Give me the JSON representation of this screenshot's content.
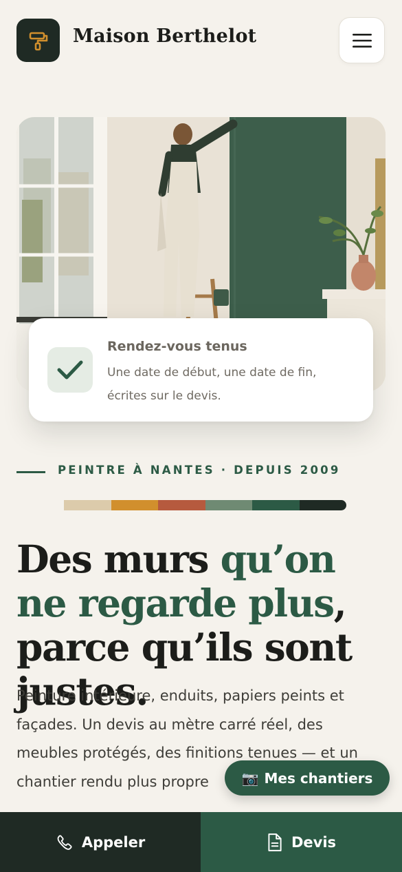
{
  "header": {
    "brand": "Maison Berthelot",
    "logo_icon": "paint-roller-icon",
    "menu_icon": "hamburger-menu-icon"
  },
  "hero": {
    "image_alt": "Peintre en salopette peignant un mur vert sauge dans un appartement haussmannien"
  },
  "card": {
    "icon": "checkmark-icon",
    "title": "Rendez-vous tenus",
    "text": "Une date de début, une date de fin, écrites sur le devis."
  },
  "eyebrow": "PEINTRE À NANTES · DEPUIS 2009",
  "palette": [
    "#dccbab",
    "#d18f2d",
    "#b65a3e",
    "#6f8a73",
    "#2c5a45",
    "#1f2a24"
  ],
  "headline": {
    "part1": "Des murs ",
    "accent": "qu’on ne regarde plus",
    "part2": ", parce qu’ils sont justes."
  },
  "lead": "Peinture intérieure, enduits, papiers peints et façades. Un devis au mètre carré réel, des meubles protégés, des finitions tenues — et un chantier rendu plus propre",
  "pill": {
    "emoji": "📷",
    "label": "Mes chantiers"
  },
  "bottom_bar": {
    "call_label": "Appeler",
    "call_icon": "phone-icon",
    "quote_label": "Devis",
    "quote_icon": "document-icon"
  },
  "colors": {
    "background": "#f5f2ec",
    "primary_green": "#2c5a45",
    "dark": "#1f2a24",
    "accent_ochre": "#d18f2d"
  }
}
